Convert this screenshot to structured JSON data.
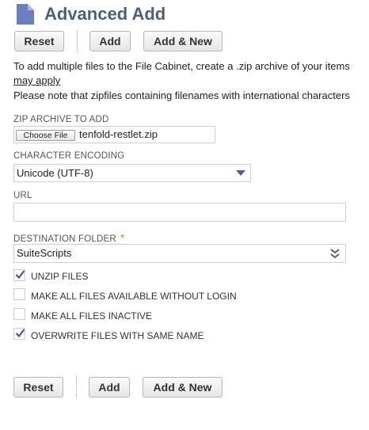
{
  "page": {
    "title": "Advanced Add"
  },
  "toolbar": {
    "reset_label": "Reset",
    "add_label": "Add",
    "add_new_label": "Add & New"
  },
  "info": {
    "line1": "To add multiple files to the File Cabinet, create a .zip archive of your items",
    "link": "may apply",
    "line2": "Please note that zipfiles containing filenames with international characters"
  },
  "form": {
    "zip": {
      "label": "ZIP ARCHIVE TO ADD",
      "button": "Choose File",
      "filename": "tenfold-restlet.zip"
    },
    "encoding": {
      "label": "CHARACTER ENCODING",
      "value": "Unicode (UTF-8)"
    },
    "url": {
      "label": "URL",
      "value": ""
    },
    "destination": {
      "label": "DESTINATION FOLDER",
      "required": "*",
      "value": "SuiteScripts"
    },
    "checkboxes": [
      {
        "label": "UNZIP FILES",
        "checked": true
      },
      {
        "label": "MAKE ALL FILES AVAILABLE WITHOUT LOGIN",
        "checked": false
      },
      {
        "label": "MAKE ALL FILES INACTIVE",
        "checked": false
      },
      {
        "label": "OVERWRITE FILES WITH SAME NAME",
        "checked": true
      }
    ]
  },
  "colors": {
    "title": "#4d5f79",
    "icon": "#6b7fc0",
    "checkmark": "#3d5a99",
    "required": "#e39100"
  },
  "icons": {
    "title": "document-icon",
    "encoding_arrow": "triangle-down-icon",
    "folder_arrow": "double-chevron-icon",
    "check": "checkmark-icon"
  }
}
